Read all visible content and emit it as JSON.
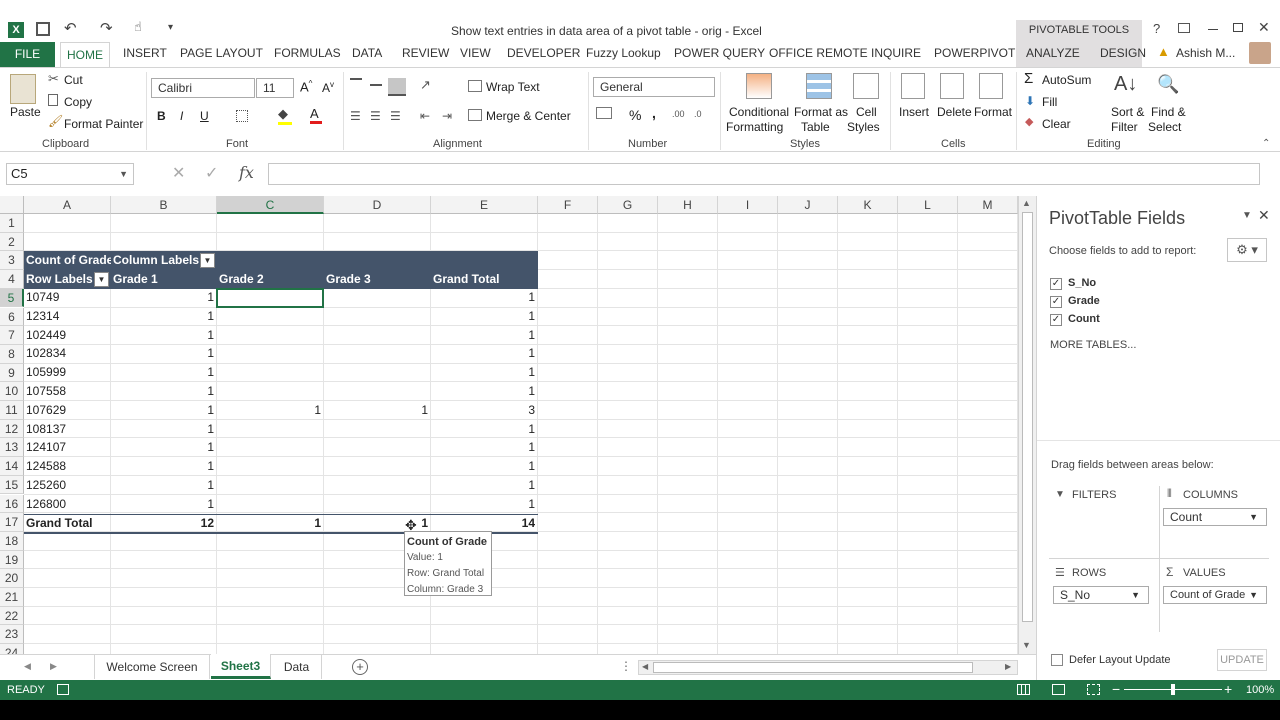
{
  "window": {
    "title": "Show text entries in data area of a pivot table - orig - Excel",
    "context_tab": "PIVOTABLE TOOLS",
    "user": "Ashish M..."
  },
  "tabs": [
    "FILE",
    "HOME",
    "INSERT",
    "PAGE LAYOUT",
    "FORMULAS",
    "DATA",
    "REVIEW",
    "VIEW",
    "DEVELOPER",
    "Fuzzy Lookup",
    "POWER QUERY",
    "OFFICE REMOTE",
    "INQUIRE",
    "POWERPIVOT",
    "ANALYZE",
    "DESIGN"
  ],
  "ribbon": {
    "clipboard": {
      "paste": "Paste",
      "cut": "Cut",
      "copy": "Copy",
      "format_painter": "Format Painter",
      "label": "Clipboard"
    },
    "font": {
      "name": "Calibri",
      "size": "11",
      "bold": "B",
      "italic": "I",
      "underline": "U",
      "label": "Font"
    },
    "alignment": {
      "wrap": "Wrap Text",
      "merge": "Merge & Center",
      "label": "Alignment"
    },
    "number": {
      "format": "General",
      "percent": "%",
      "comma": ",",
      "label": "Number"
    },
    "styles": {
      "conditional": "Conditional",
      "conditional2": "Formatting",
      "format_as": "Format as",
      "format_as2": "Table",
      "cell": "Cell",
      "cell2": "Styles",
      "label": "Styles"
    },
    "cells": {
      "insert": "Insert",
      "delete": "Delete",
      "format": "Format",
      "label": "Cells"
    },
    "editing": {
      "autosum": "AutoSum",
      "fill": "Fill",
      "clear": "Clear",
      "sort": "Sort &",
      "sort2": "Filter",
      "find": "Find &",
      "find2": "Select",
      "label": "Editing"
    }
  },
  "formula_bar": {
    "name_box": "C5",
    "fx": "fx",
    "value": ""
  },
  "columns": [
    "A",
    "B",
    "C",
    "D",
    "E",
    "F",
    "G",
    "H",
    "I",
    "J",
    "K",
    "L",
    "M"
  ],
  "rows": [
    "1",
    "2",
    "3",
    "4",
    "5",
    "6",
    "7",
    "8",
    "9",
    "10",
    "11",
    "12",
    "13",
    "14",
    "15",
    "16",
    "17",
    "18",
    "19",
    "20",
    "21",
    "22",
    "23",
    "24"
  ],
  "pivot": {
    "value_header": "Count of Grade",
    "column_labels": "Column Labels",
    "row_labels": "Row Labels",
    "col_headers": [
      "Grade 1",
      "Grade 2",
      "Grade 3",
      "Grand Total"
    ],
    "rows": [
      {
        "label": "10749",
        "g1": "1",
        "g2": "",
        "g3": "",
        "total": "1"
      },
      {
        "label": "12314",
        "g1": "1",
        "g2": "",
        "g3": "",
        "total": "1"
      },
      {
        "label": "102449",
        "g1": "1",
        "g2": "",
        "g3": "",
        "total": "1"
      },
      {
        "label": "102834",
        "g1": "1",
        "g2": "",
        "g3": "",
        "total": "1"
      },
      {
        "label": "105999",
        "g1": "1",
        "g2": "",
        "g3": "",
        "total": "1"
      },
      {
        "label": "107558",
        "g1": "1",
        "g2": "",
        "g3": "",
        "total": "1"
      },
      {
        "label": "107629",
        "g1": "1",
        "g2": "1",
        "g3": "1",
        "total": "3"
      },
      {
        "label": "108137",
        "g1": "1",
        "g2": "",
        "g3": "",
        "total": "1"
      },
      {
        "label": "124107",
        "g1": "1",
        "g2": "",
        "g3": "",
        "total": "1"
      },
      {
        "label": "124588",
        "g1": "1",
        "g2": "",
        "g3": "",
        "total": "1"
      },
      {
        "label": "125260",
        "g1": "1",
        "g2": "",
        "g3": "",
        "total": "1"
      },
      {
        "label": "126800",
        "g1": "1",
        "g2": "",
        "g3": "",
        "total": "1"
      }
    ],
    "grand_total": {
      "label": "Grand Total",
      "g1": "12",
      "g2": "1",
      "g3": "1",
      "total": "14"
    }
  },
  "tooltip": {
    "title": "Count of Grade",
    "value": "Value: 1",
    "row": "Row: Grand Total",
    "column": "Column: Grade 3"
  },
  "pane": {
    "title": "PivotTable Fields",
    "choose": "Choose fields to add to report:",
    "fields": [
      {
        "name": "S_No",
        "checked": true
      },
      {
        "name": "Grade",
        "checked": true
      },
      {
        "name": "Count",
        "checked": true
      }
    ],
    "more_tables": "MORE TABLES...",
    "drag": "Drag fields between areas below:",
    "filters": "FILTERS",
    "columns": "COLUMNS",
    "columns_value": "Count",
    "rows": "ROWS",
    "rows_value": "S_No",
    "values": "VALUES",
    "values_value": "Count of Grade",
    "defer": "Defer Layout Update",
    "update": "UPDATE"
  },
  "sheets": {
    "tabs": [
      "Welcome Screen",
      "Sheet3",
      "Data"
    ],
    "active": "Sheet3"
  },
  "status": {
    "ready": "READY",
    "zoom": "100%"
  },
  "colors": {
    "excel_green": "#217346",
    "pivot_header": "#44546a",
    "context_tab": "#e1dfe0"
  }
}
